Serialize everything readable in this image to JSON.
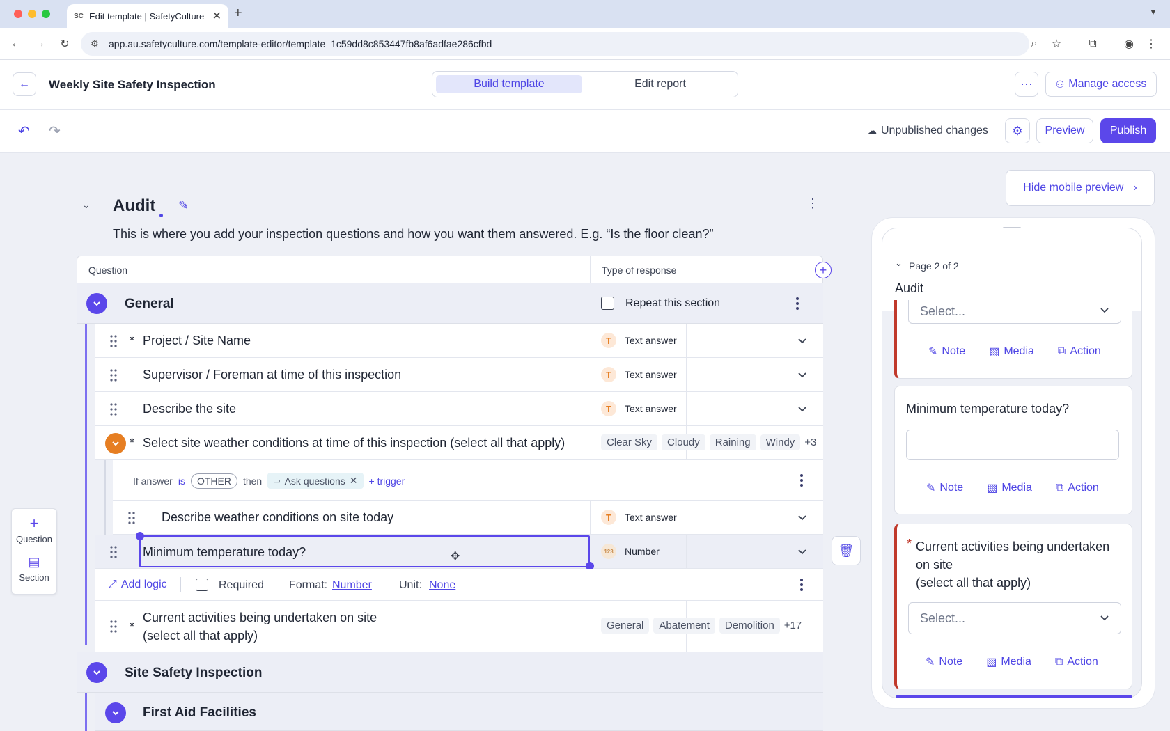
{
  "browser": {
    "tab_title": "Edit template | SafetyCulture",
    "tab_favicon": "SC",
    "url": "app.au.safetyculture.com/template-editor/template_1c59dd8c853447fb8af6adfae286cfbd"
  },
  "header": {
    "template_title": "Weekly Site Safety Inspection",
    "tabs": [
      "Build template",
      "Edit report"
    ],
    "manage_access": "Manage access"
  },
  "toolbar": {
    "status": "Unpublished changes",
    "preview": "Preview",
    "publish": "Publish"
  },
  "page": {
    "title": "Audit",
    "description": "This is where you add your inspection questions and how you want them answered. E.g. “Is the floor clean?”",
    "hide_preview": "Hide mobile preview"
  },
  "table": {
    "col_question": "Question",
    "col_response": "Type of response"
  },
  "sections": {
    "general": "General",
    "repeat_label": "Repeat this section",
    "site_safety": "Site Safety Inspection",
    "first_aid": "First Aid Facilities"
  },
  "questions": [
    {
      "required": "*",
      "text": "Project / Site Name",
      "response": "Text answer"
    },
    {
      "required": "",
      "text": "Supervisor / Foreman at time of this inspection",
      "response": "Text answer"
    },
    {
      "required": "",
      "text": "Describe the site",
      "response": "Text answer"
    },
    {
      "required": "*",
      "text": "Select site weather conditions at time of this inspection (select all that apply)",
      "options": [
        "Clear Sky",
        "Cloudy",
        "Raining",
        "Windy"
      ],
      "more": "+3"
    },
    {
      "required": "",
      "text": "Describe weather conditions on site today",
      "response": "Text answer"
    },
    {
      "required": "",
      "text": "Minimum temperature today?",
      "response": "Number",
      "number_icon": "123"
    },
    {
      "required": "*",
      "text_line1": "Current activities being undertaken on site",
      "text_line2": "(select all that apply)",
      "options": [
        "General",
        "Abatement",
        "Demolition"
      ],
      "more": "+17"
    }
  ],
  "logic": {
    "if_answer": "If answer",
    "is": "is",
    "value": "OTHER",
    "then": "then",
    "action": "Ask questions",
    "trigger": "+ trigger"
  },
  "settings_row": {
    "add_logic": "Add logic",
    "required": "Required",
    "format_label": "Format:",
    "format_value": "Number",
    "unit_label": "Unit:",
    "unit_value": "None"
  },
  "left_panel": {
    "question": "Question",
    "section": "Section"
  },
  "preview": {
    "page_label": "Page 2 of 2",
    "title": "Audit",
    "select_placeholder": "Select...",
    "note": "Note",
    "media": "Media",
    "action": "Action",
    "q_min_temp": "Minimum temperature today?",
    "q_activities_l1": "Current activities being undertaken",
    "q_activities_l2": "on site",
    "q_activities_l3": "(select all that apply)",
    "required_mark": "*"
  },
  "colors": {
    "brand": "#5b47ea",
    "orange": "#e67e22",
    "required_bar": "#c0392b"
  }
}
